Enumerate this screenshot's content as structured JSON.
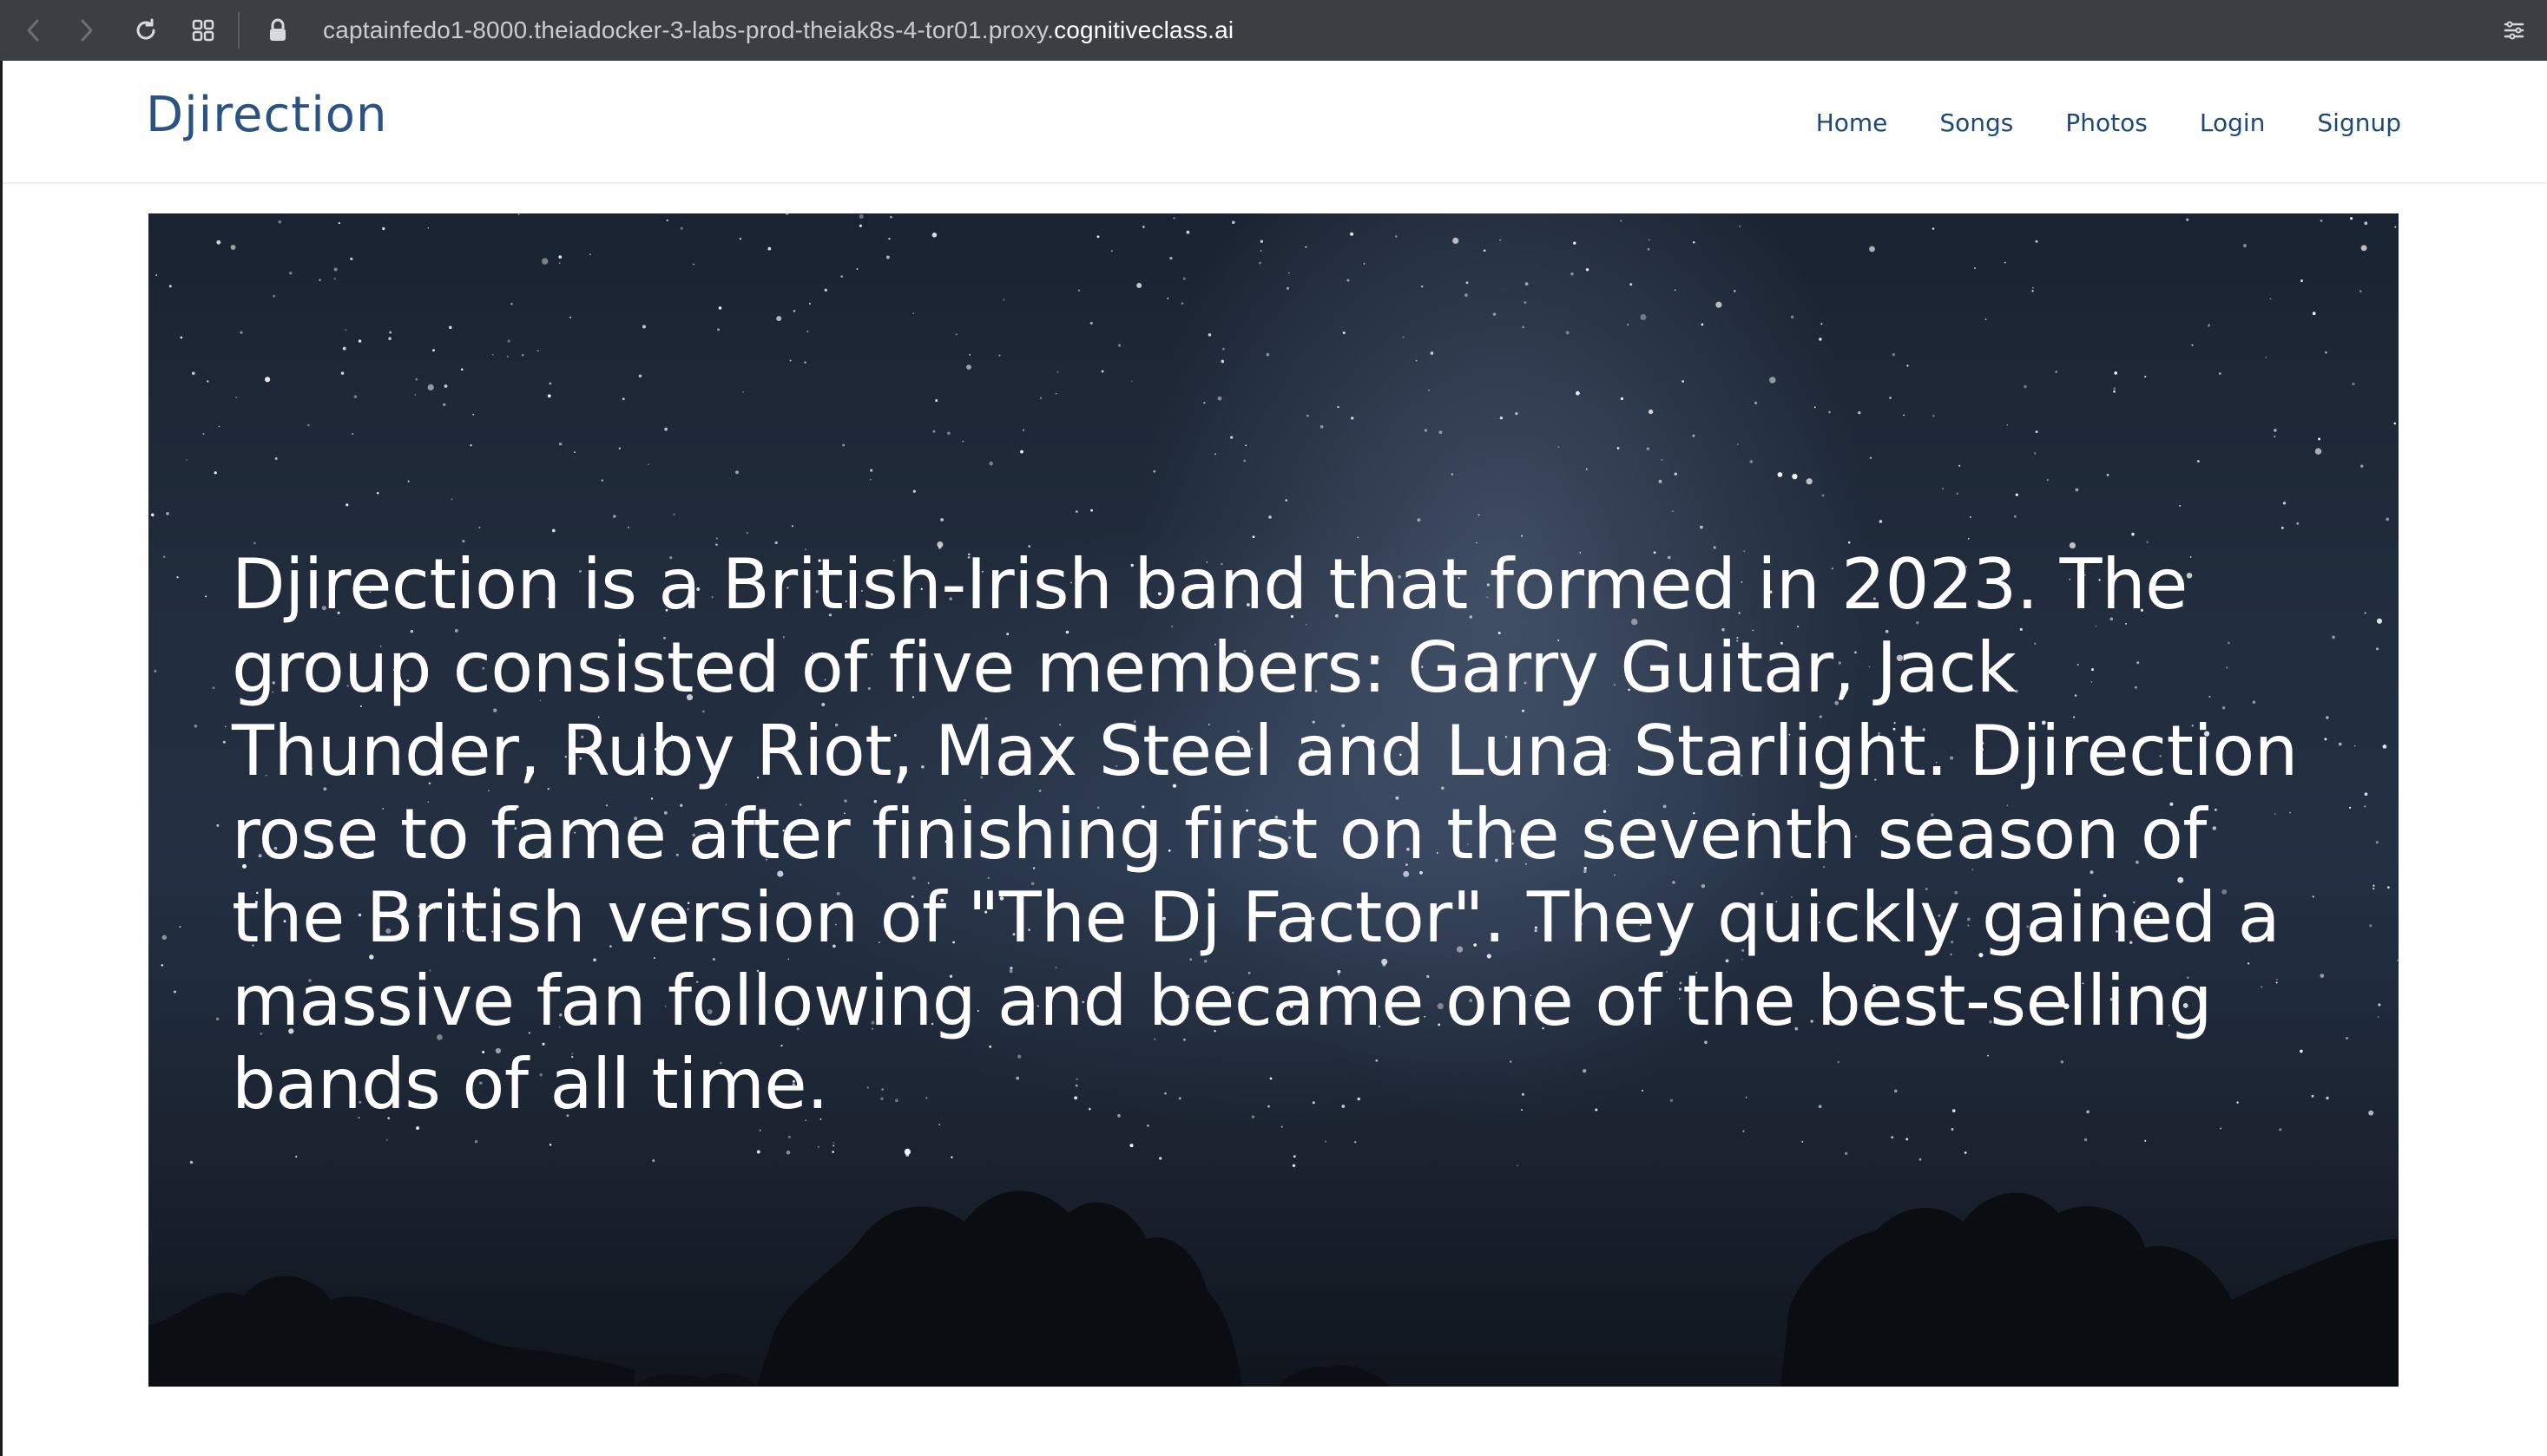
{
  "browser": {
    "url_prefix": "captainfedo1-8000.theiadocker-3-labs-prod-theiak8s-4-tor01.proxy.",
    "url_domain": "cognitiveclass.ai",
    "icons": [
      "back-arrow-icon",
      "forward-arrow-icon",
      "reload-icon",
      "tab-overview-icon",
      "lock-icon",
      "reader-menu-icon"
    ]
  },
  "header": {
    "brand": "Djirection",
    "nav": [
      {
        "label": "Home"
      },
      {
        "label": "Songs"
      },
      {
        "label": "Photos"
      },
      {
        "label": "Login"
      },
      {
        "label": "Signup"
      }
    ]
  },
  "hero": {
    "text": "Djirection is a British-Irish band that formed in 2023. The group consisted of five members: Garry Guitar, Jack Thunder, Ruby Riot, Max Steel and Luna Starlight. Djirection rose to fame after finishing first on the seventh season of the British version of \"The Dj Factor\". They quickly gained a massive fan following and became one of the best-selling bands of all time.",
    "background": "starry night sky with tree silhouettes"
  },
  "colors": {
    "brand": "#2a5282",
    "nav_link": "#1f4a78",
    "browser_bar": "#3b3f44",
    "hero_text": "#ffffff"
  }
}
